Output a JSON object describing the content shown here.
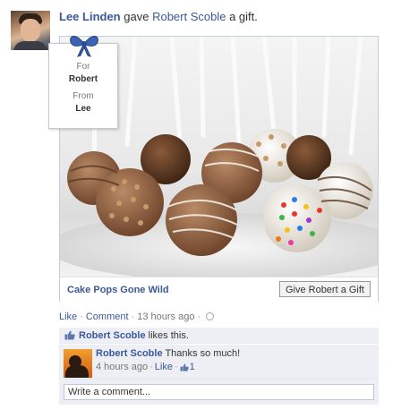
{
  "story": {
    "actor": "Lee Linden",
    "verb": "gave",
    "recipient": "Robert Scoble",
    "object": "a gift."
  },
  "tag": {
    "for_label": "For",
    "for_name": "Robert",
    "from_label": "From",
    "from_name": "Lee"
  },
  "gift": {
    "name": "Cake Pops Gone Wild",
    "give_button": "Give Robert a Gift"
  },
  "actions": {
    "like": "Like",
    "comment": "Comment",
    "time": "13 hours ago"
  },
  "likes": {
    "who": "Robert Scoble",
    "text": "likes this."
  },
  "comment": {
    "author": "Robert Scoble",
    "text": "Thanks so much!",
    "time": "4 hours ago",
    "like": "Like",
    "like_count": "1"
  },
  "composer": {
    "placeholder": "Write a comment..."
  },
  "colors": {
    "link": "#3b5998",
    "feedback_bg": "#edeff4",
    "bow": "#3c62b4"
  }
}
